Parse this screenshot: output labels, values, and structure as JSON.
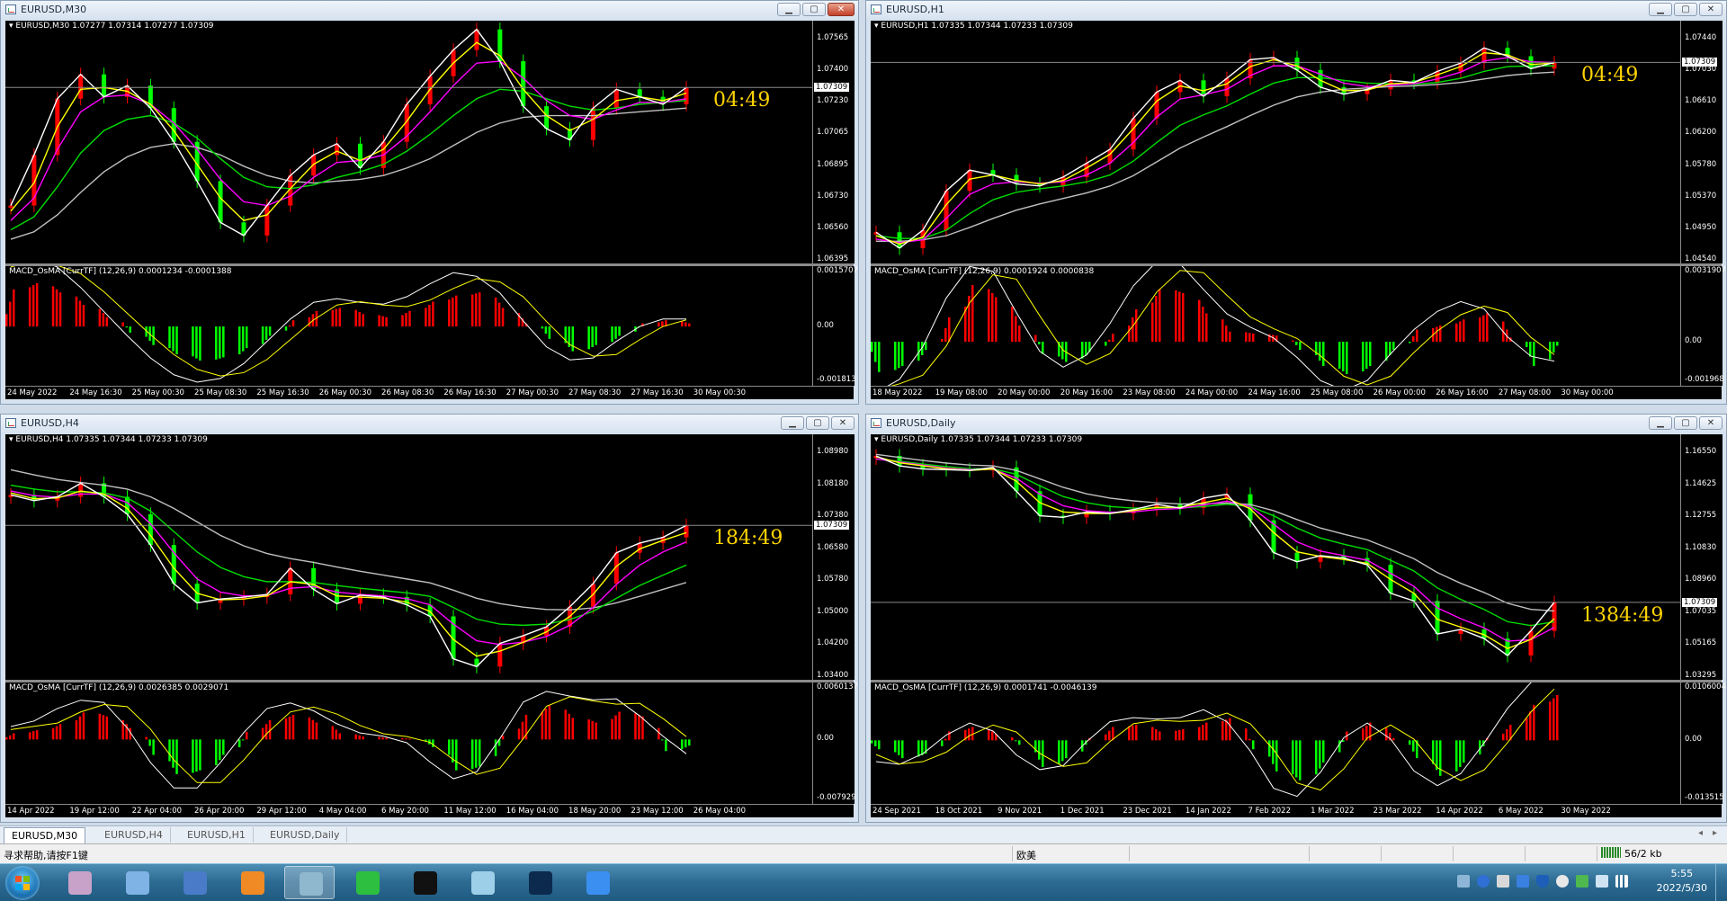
{
  "windows": [
    {
      "id": "m30",
      "title": "EURUSD,M30",
      "header": "EURUSD,M30  1.07277 1.07314 1.07277 1.07309",
      "macd_header": "MACD_OsMA [CurrTF] (12,26,9) 0.0001234 -0.0001388",
      "countdown": "04:49",
      "current_price": "1.07309",
      "price_ticks": [
        "1.07565",
        "1.07400",
        "1.07230",
        "1.07065",
        "1.06895",
        "1.06730",
        "1.06560",
        "1.06395"
      ],
      "macd_ticks": [
        "0.0015707",
        "0.00",
        "-0.001813"
      ],
      "time_labels": [
        "24 May 2022",
        "24 May 16:30",
        "25 May 00:30",
        "25 May 08:30",
        "25 May 16:30",
        "26 May 00:30",
        "26 May 08:30",
        "26 May 16:30",
        "27 May 00:30",
        "27 May 08:30",
        "27 May 16:30",
        "30 May 00:30"
      ],
      "series": {
        "close": [
          1.0668,
          1.0695,
          1.0725,
          1.0738,
          1.0726,
          1.0732,
          1.072,
          1.0702,
          1.0681,
          1.0659,
          1.0652,
          1.0668,
          1.0684,
          1.0695,
          1.0701,
          1.0688,
          1.0702,
          1.0722,
          1.0737,
          1.0751,
          1.0762,
          1.0745,
          1.0721,
          1.0709,
          1.0703,
          1.072,
          1.073,
          1.0726,
          1.0722,
          1.0731
        ],
        "ma_fast": [
          1.0665,
          1.068,
          1.071,
          1.073,
          1.0731,
          1.0729,
          1.0722,
          1.0708,
          1.069,
          1.0672,
          1.066,
          1.0663,
          1.0677,
          1.069,
          1.0697,
          1.0692,
          1.0698,
          1.0713,
          1.073,
          1.0744,
          1.0755,
          1.0748,
          1.073,
          1.0716,
          1.0708,
          1.0714,
          1.0724,
          1.0726,
          1.0724,
          1.0728
        ],
        "ma_mid": [
          1.066,
          1.0672,
          1.0698,
          1.0718,
          1.0726,
          1.0727,
          1.0722,
          1.0712,
          1.0698,
          1.0682,
          1.067,
          1.0668,
          1.0673,
          1.0683,
          1.0691,
          1.0692,
          1.0695,
          1.0705,
          1.0718,
          1.0732,
          1.0744,
          1.0745,
          1.0736,
          1.0724,
          1.0716,
          1.0714,
          1.0719,
          1.0723,
          1.0723,
          1.0725
        ],
        "ma_slow": [
          1.0655,
          1.0662,
          1.0678,
          1.0696,
          1.0708,
          1.0714,
          1.0716,
          1.0712,
          1.0704,
          1.0693,
          1.0683,
          1.0678,
          1.0677,
          1.0679,
          1.0683,
          1.0686,
          1.069,
          1.0697,
          1.0706,
          1.0716,
          1.0725,
          1.073,
          1.0729,
          1.0725,
          1.0721,
          1.0719,
          1.072,
          1.0722,
          1.0723,
          1.0724
        ],
        "ma_long": [
          1.065,
          1.0654,
          1.0663,
          1.0675,
          1.0686,
          1.0694,
          1.0699,
          1.0701,
          1.0699,
          1.0695,
          1.0689,
          1.0684,
          1.0681,
          1.068,
          1.0681,
          1.0682,
          1.0684,
          1.0688,
          1.0693,
          1.07,
          1.0707,
          1.0712,
          1.0715,
          1.0716,
          1.0716,
          1.0716,
          1.0717,
          1.0718,
          1.0719,
          1.072
        ]
      },
      "price_min": 1.0639,
      "price_max": 1.0758,
      "macd": [
        0.0012,
        0.0014,
        0.0011,
        0.0007,
        0.0003,
        -0.0002,
        -0.0006,
        -0.0009,
        -0.0011,
        -0.001,
        -0.0007,
        -0.0003,
        0.0002,
        0.0005,
        0.0006,
        0.0004,
        0.0003,
        0.0005,
        0.0008,
        0.001,
        0.0011,
        0.0006,
        0.0001,
        -0.0004,
        -0.0008,
        -0.0006,
        -0.0003,
        0.0001,
        0.0002,
        0.0001
      ],
      "macd_min": -0.0018,
      "macd_max": 0.0016
    },
    {
      "id": "h1",
      "title": "EURUSD,H1",
      "header": "EURUSD,H1  1.07335 1.07344 1.07233 1.07309",
      "macd_header": "MACD_OsMA [CurrTF] (12,26,9) 0.0001924 0.0000838",
      "countdown": "04:49",
      "current_price": "1.07309",
      "price_ticks": [
        "1.07440",
        "1.07030",
        "1.06610",
        "1.06200",
        "1.05780",
        "1.05370",
        "1.04950",
        "1.04540"
      ],
      "macd_ticks": [
        "0.0031907",
        "0.00",
        "-0.001968"
      ],
      "time_labels": [
        "18 May 2022",
        "19 May 08:00",
        "20 May 00:00",
        "20 May 16:00",
        "23 May 08:00",
        "24 May 00:00",
        "24 May 16:00",
        "25 May 08:00",
        "26 May 00:00",
        "26 May 16:00",
        "27 May 08:00",
        "30 May 00:00"
      ],
      "series": {
        "close": [
          1.0485,
          1.0462,
          1.0488,
          1.0545,
          1.0575,
          1.0568,
          1.0555,
          1.0552,
          1.0565,
          1.0585,
          1.0605,
          1.065,
          1.0688,
          1.0705,
          1.0682,
          1.0708,
          1.0735,
          1.0738,
          1.072,
          1.0695,
          1.0685,
          1.0692,
          1.0705,
          1.0702,
          1.0718,
          1.073,
          1.0752,
          1.074,
          1.0722,
          1.0731
        ],
        "ma_fast": [
          1.048,
          1.0468,
          1.0478,
          1.0525,
          1.0562,
          1.0568,
          1.056,
          1.0555,
          1.056,
          1.0578,
          1.0598,
          1.0635,
          1.0675,
          1.0697,
          1.069,
          1.07,
          1.0725,
          1.0735,
          1.0726,
          1.0705,
          1.069,
          1.0691,
          1.07,
          1.0702,
          1.0713,
          1.0725,
          1.0745,
          1.0742,
          1.0728,
          1.073
        ],
        "ma_mid": [
          1.0475,
          1.047,
          1.0474,
          1.0505,
          1.054,
          1.0555,
          1.0558,
          1.0556,
          1.0558,
          1.0568,
          1.0585,
          1.0615,
          1.0652,
          1.0678,
          1.0684,
          1.0692,
          1.0712,
          1.0726,
          1.0726,
          1.0714,
          1.0701,
          1.0696,
          1.0698,
          1.07,
          1.0707,
          1.0717,
          1.0733,
          1.0738,
          1.0732,
          1.0731
        ],
        "ma_slow": [
          1.048,
          1.0476,
          1.0476,
          1.0488,
          1.0512,
          1.0532,
          1.0543,
          1.0548,
          1.0552,
          1.0558,
          1.0568,
          1.0588,
          1.0615,
          1.064,
          1.0655,
          1.0668,
          1.0685,
          1.0701,
          1.0709,
          1.0709,
          1.0705,
          1.0701,
          1.07,
          1.0699,
          1.0702,
          1.0708,
          1.0718,
          1.0725,
          1.0726,
          1.0726
        ],
        "ma_long": [
          1.0472,
          1.0472,
          1.0474,
          1.048,
          1.0492,
          1.0505,
          1.0517,
          1.0526,
          1.0534,
          1.0542,
          1.0552,
          1.0567,
          1.0587,
          1.0607,
          1.0623,
          1.0638,
          1.0654,
          1.0669,
          1.0681,
          1.0688,
          1.0692,
          1.0694,
          1.0696,
          1.0697,
          1.0699,
          1.0702,
          1.0707,
          1.0712,
          1.0715,
          1.0717
        ]
      },
      "price_min": 1.0445,
      "price_max": 1.0768,
      "macd": [
        -0.0015,
        -0.0012,
        -0.0004,
        0.0012,
        0.0028,
        0.0022,
        0.0008,
        -0.0006,
        -0.001,
        -0.0005,
        0.0004,
        0.0016,
        0.0026,
        0.0024,
        0.0014,
        0.0005,
        0.0004,
        0.0003,
        -0.0004,
        -0.0012,
        -0.0016,
        -0.0012,
        -0.0004,
        0.0006,
        0.0008,
        0.0011,
        0.0014,
        0.0002,
        -0.0012,
        -0.0002
      ],
      "macd_min": -0.002,
      "macd_max": 0.0032
    },
    {
      "id": "h4",
      "title": "EURUSD,H4",
      "header": "EURUSD,H4  1.07335 1.07344 1.07233 1.07309",
      "macd_header": "MACD_OsMA [CurrTF] (12,26,9) 0.0026385 0.0029071",
      "countdown": "184:49",
      "current_price": "1.07309",
      "price_ticks": [
        "1.08980",
        "1.08180",
        "1.07380",
        "1.06580",
        "1.05780",
        "1.05000",
        "1.04200",
        "1.03400"
      ],
      "macd_ticks": [
        "0.0060137",
        "0.00",
        "-0.007929"
      ],
      "time_labels": [
        "14 Apr 2022",
        "19 Apr 12:00",
        "22 Apr 04:00",
        "26 Apr 20:00",
        "29 Apr 12:00",
        "4 May 04:00",
        "6 May 20:00",
        "11 May 12:00",
        "16 May 04:00",
        "18 May 20:00",
        "23 May 12:00",
        "26 May 04:00"
      ],
      "series": {
        "close": [
          1.081,
          1.0795,
          1.0805,
          1.084,
          1.0805,
          1.076,
          1.068,
          1.058,
          1.053,
          1.054,
          1.0545,
          1.0552,
          1.062,
          1.0565,
          1.0528,
          1.055,
          1.0545,
          1.0525,
          1.0495,
          1.0385,
          1.0365,
          1.0425,
          1.0445,
          1.0468,
          1.052,
          1.058,
          1.066,
          1.0685,
          1.07,
          1.0731
        ],
        "ma_fast": [
          1.0815,
          1.08,
          1.0802,
          1.082,
          1.0812,
          1.0775,
          1.0705,
          1.062,
          1.0555,
          1.0538,
          1.054,
          1.0548,
          1.0585,
          1.0578,
          1.0548,
          1.0545,
          1.0542,
          1.0532,
          1.0508,
          1.0435,
          1.0392,
          1.0405,
          1.0428,
          1.0455,
          1.0495,
          1.0552,
          1.0625,
          1.067,
          1.0692,
          1.0712
        ],
        "ma_mid": [
          1.082,
          1.0808,
          1.0804,
          1.0812,
          1.0812,
          1.079,
          1.0735,
          1.066,
          1.0592,
          1.0558,
          1.0548,
          1.0549,
          1.0568,
          1.0572,
          1.0558,
          1.0552,
          1.0548,
          1.0541,
          1.0525,
          1.0475,
          1.0432,
          1.0422,
          1.0428,
          1.0443,
          1.0472,
          1.0518,
          1.0578,
          1.0628,
          1.0662,
          1.0688
        ],
        "ma_slow": [
          1.0835,
          1.0825,
          1.0818,
          1.0818,
          1.0815,
          1.0802,
          1.0768,
          1.0715,
          1.0662,
          1.0622,
          1.0598,
          1.0585,
          1.0585,
          1.0583,
          1.0575,
          1.0568,
          1.0562,
          1.0556,
          1.0547,
          1.0518,
          1.0488,
          1.0475,
          1.0472,
          1.0475,
          1.0487,
          1.0508,
          1.0542,
          1.0575,
          1.0602,
          1.0628
        ],
        "ma_long": [
          1.0875,
          1.0862,
          1.085,
          1.0842,
          1.0835,
          1.0825,
          1.0805,
          1.0775,
          1.074,
          1.0705,
          1.0678,
          1.0658,
          1.0645,
          1.0635,
          1.0623,
          1.0612,
          1.0602,
          1.0592,
          1.0582,
          1.0563,
          1.0542,
          1.0528,
          1.0519,
          1.0513,
          1.0512,
          1.0517,
          1.053,
          1.0547,
          1.0565,
          1.0583
        ]
      },
      "price_min": 1.034,
      "price_max": 1.0925,
      "macd": [
        0.0008,
        0.0012,
        0.002,
        0.0035,
        0.003,
        0.0015,
        -0.002,
        -0.0045,
        -0.004,
        -0.002,
        0.001,
        0.0025,
        0.0032,
        0.0022,
        0.0008,
        0.0004,
        0.0002,
        0.0001,
        -0.001,
        -0.004,
        -0.0035,
        0.0005,
        0.0032,
        0.0044,
        0.0028,
        0.0022,
        0.0036,
        0.003,
        -0.0015,
        -0.0008
      ],
      "macd_min": -0.0079,
      "macd_max": 0.006
    },
    {
      "id": "d1",
      "title": "EURUSD,Daily",
      "header": "EURUSD,Daily  1.07335 1.07344 1.07233 1.07309",
      "macd_header": "MACD_OsMA [CurrTF] (12,26,9) 0.0001741 -0.0046139",
      "countdown": "1384:49",
      "current_price": "1.07309",
      "price_ticks": [
        "1.16550",
        "1.14625",
        "1.12755",
        "1.10830",
        "1.08960",
        "1.07035",
        "1.05165",
        "1.03295"
      ],
      "macd_ticks": [
        "0.0106004",
        "0.00",
        "-0.013515"
      ],
      "time_labels": [
        "24 Sep 2021",
        "18 Oct 2021",
        "9 Nov 2021",
        "1 Dec 2021",
        "23 Dec 2021",
        "14 Jan 2022",
        "7 Feb 2022",
        "1 Mar 2022",
        "23 Mar 2022",
        "14 Apr 2022",
        "6 May 2022",
        "30 May 2022"
      ],
      "series": {
        "close": [
          1.1685,
          1.162,
          1.16,
          1.1595,
          1.159,
          1.161,
          1.1455,
          1.1295,
          1.1285,
          1.132,
          1.131,
          1.1335,
          1.137,
          1.1345,
          1.141,
          1.1435,
          1.1265,
          1.1055,
          1.0995,
          1.1035,
          1.102,
          1.0975,
          1.079,
          1.074,
          1.0525,
          1.0555,
          1.0495,
          1.0385,
          1.0545,
          1.0731
        ],
        "ma_fast": [
          1.168,
          1.164,
          1.162,
          1.16,
          1.159,
          1.16,
          1.152,
          1.138,
          1.132,
          1.131,
          1.131,
          1.1328,
          1.135,
          1.135,
          1.138,
          1.141,
          1.134,
          1.1185,
          1.106,
          1.103,
          1.101,
          1.0985,
          1.088,
          1.079,
          1.062,
          1.057,
          1.052,
          1.043,
          1.049,
          1.0625
        ],
        "ma_mid": [
          1.1665,
          1.1645,
          1.1625,
          1.1605,
          1.1595,
          1.1598,
          1.154,
          1.1435,
          1.136,
          1.1328,
          1.1318,
          1.132,
          1.1335,
          1.1342,
          1.1365,
          1.139,
          1.1355,
          1.124,
          1.1125,
          1.1065,
          1.1035,
          1.1005,
          1.092,
          1.0835,
          1.0695,
          1.0625,
          1.0565,
          1.0478,
          1.0488,
          1.0568
        ],
        "ma_slow": [
          1.1665,
          1.165,
          1.1632,
          1.1615,
          1.1602,
          1.16,
          1.1565,
          1.149,
          1.142,
          1.138,
          1.1355,
          1.1345,
          1.1345,
          1.1345,
          1.1355,
          1.137,
          1.1355,
          1.1295,
          1.1215,
          1.115,
          1.111,
          1.1075,
          1.1005,
          1.0935,
          1.0825,
          1.075,
          1.0685,
          1.0605,
          1.058,
          1.0605
        ],
        "ma_long": [
          1.1695,
          1.1675,
          1.1655,
          1.1638,
          1.1625,
          1.162,
          1.159,
          1.1535,
          1.148,
          1.1438,
          1.141,
          1.1392,
          1.138,
          1.1372,
          1.1372,
          1.1378,
          1.1368,
          1.1328,
          1.127,
          1.1215,
          1.1175,
          1.1138,
          1.1078,
          1.1015,
          1.0925,
          1.0855,
          1.0795,
          1.0725,
          1.0685,
          1.0675
        ]
      },
      "price_min": 1.025,
      "price_max": 1.172,
      "macd": [
        -0.002,
        -0.004,
        -0.003,
        0.002,
        0.003,
        0.0015,
        -0.001,
        -0.006,
        -0.004,
        0.0005,
        0.003,
        0.0035,
        0.002,
        0.0025,
        0.004,
        0.005,
        -0.002,
        -0.007,
        -0.009,
        -0.005,
        0.002,
        0.004,
        0.0005,
        -0.004,
        -0.008,
        -0.005,
        0.0005,
        0.0035,
        0.008,
        0.0102
      ],
      "macd_min": -0.0135,
      "macd_max": 0.0106
    }
  ],
  "tabs": [
    "EURUSD,M30",
    "EURUSD,H4",
    "EURUSD,H1",
    "EURUSD,Daily"
  ],
  "active_tab": "EURUSD,M30",
  "status": {
    "help_text": "寻求帮助,请按F1键",
    "profile": "欧美",
    "connection": "56/2 kb"
  },
  "taskbar": {
    "apps": [
      {
        "name": "paint-app",
        "color": "#c8a2c8"
      },
      {
        "name": "network-app",
        "color": "#7fb2e5"
      },
      {
        "name": "desktop-app",
        "color": "#4a7bc8"
      },
      {
        "name": "orange-arrow-app",
        "color": "#f08a24"
      },
      {
        "name": "trading-terminal-app",
        "color": "#8fb8cf"
      },
      {
        "name": "wechat-app",
        "color": "#2dbf3f"
      },
      {
        "name": "capcut-app",
        "color": "#111111"
      },
      {
        "name": "notebook-app",
        "color": "#9ecfe8"
      },
      {
        "name": "photoshop-app",
        "color": "#0c2a4d"
      },
      {
        "name": "pen-app",
        "color": "#3b8ff0"
      }
    ],
    "time": "5:55",
    "date": "2022/5/30"
  },
  "colors": {
    "bull": "#ff0000",
    "bear": "#00ff00",
    "ma_fast": "#ffffff",
    "ma_mid": "#ffff00",
    "ma_slow": "#ff00ff",
    "ma_green": "#00dd00",
    "ma_long": "#c0c0c0",
    "countdown": "#ffd400"
  }
}
